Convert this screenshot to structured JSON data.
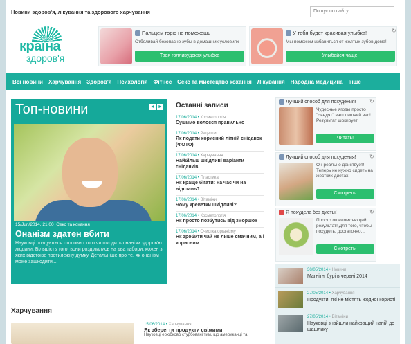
{
  "header": {
    "tagline": "Новини здоров'я, лікування та здорового харчування",
    "search_placeholder": "Пошук по сайту"
  },
  "logo": {
    "line1": "країна",
    "line2": "здоров'я"
  },
  "ads": [
    {
      "title": "Пальцем горю не поможешь",
      "text": "Отбеливай безопасно зубы в домашних условиях",
      "button": "Твоя голливудская улыбка"
    },
    {
      "title": "У тебя будет красивая улыбка!",
      "text": "Мы поможем избавиться от желтых зубов дома!",
      "button": "Улыбайся чаще!"
    }
  ],
  "nav": [
    "Всі новини",
    "Харчування",
    "Здоров'я",
    "Психологія",
    "Фітнес",
    "Секс та мистецтво кохання",
    "Лікування",
    "Народна медицина",
    "Інше"
  ],
  "top_news": {
    "heading": "Топ-новини",
    "prev": "◄",
    "next": "►",
    "date": "15/Jun/2014, 21:00",
    "category": "Секс та кохання",
    "title": "Онанізм здатен вбити",
    "text": "Науковці роздуються стосовно того чи шкодить онанізм здоров'ю людини. Більшість того, вони розділились на два табори, кожен з яких відстоює протилежну думку. Детальніше про те, як онанізм може зашкодити..."
  },
  "latest": {
    "heading": "Останні записи",
    "items": [
      {
        "date": "17/06/2014",
        "cat": "Косметологія",
        "title": "Сушимо волосся правильно"
      },
      {
        "date": "17/06/2014",
        "cat": "Рецепти",
        "title": "Як подати корисний літній сніданок (ФОТО)"
      },
      {
        "date": "17/06/2014",
        "cat": "Харчування",
        "title": "Найбільш шкідливі варіанти сніданків"
      },
      {
        "date": "17/06/2014",
        "cat": "Пластика",
        "title": "Як краще бігати: на час чи на відстань?"
      },
      {
        "date": "17/06/2014",
        "cat": "Вітаміни",
        "title": "Чому креветки шкідливі?"
      },
      {
        "date": "17/06/2014",
        "cat": "Косметологія",
        "title": "Як просто позбутись від зморшок"
      },
      {
        "date": "17/06/2014",
        "cat": "Очистка організму",
        "title": "Як зробити чай не лише смачним, а і корисним"
      }
    ]
  },
  "side_ads": [
    {
      "title": "Лучший способ для похудения!",
      "text": "Чудесные ягоды просто \"съедят\" ваш лишний вес! Результат шокирует!",
      "button": "Читать!"
    },
    {
      "title": "Лучший способ для похудения!",
      "text": "Он реально действует! Теперь не нужно сидеть на жестких диетах!",
      "button": "Смотреть!"
    },
    {
      "title": "Я похудела без диеты!",
      "text": "Просто ошеломляющий результат! Для того, чтобы похудеть, достаточно...",
      "button": "Смотреть!"
    }
  ],
  "side_news": [
    {
      "date": "30/05/2014",
      "cat": "Новини",
      "title": "Магнітні бурі в червні 2014"
    },
    {
      "date": "27/05/2014",
      "cat": "Харчування",
      "title": "Продукти, які не містять жодної користі"
    },
    {
      "date": "27/05/2014",
      "cat": "Вітаміни",
      "title": "Науковці знайшли найкращий напій до шашлику"
    }
  ],
  "section": {
    "heading": "Харчування"
  },
  "food": {
    "date": "15/06/2014",
    "cat": "Харчування",
    "title": "Як зберегти продукти свіжими",
    "text": "Науковці ерюбково стурбовані тим, що американці та"
  },
  "colors": {
    "accent": "#1cae9d",
    "button_green": "#2cbf6f"
  }
}
